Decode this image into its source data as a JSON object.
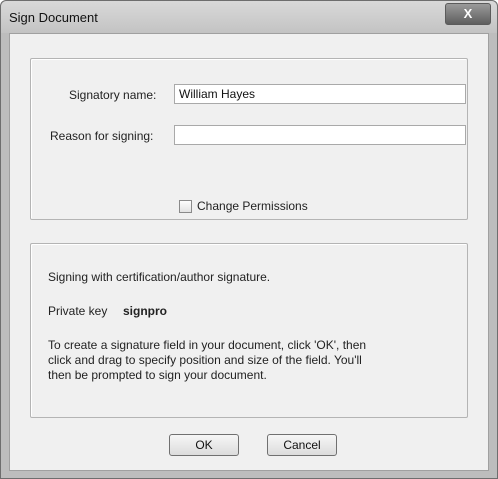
{
  "window": {
    "title": "Sign Document",
    "close_glyph": "X"
  },
  "signatory": {
    "name_label": "Signatory name:",
    "name_value": "William Hayes",
    "reason_label": "Reason for signing:",
    "reason_value": "",
    "permissions_label": "Change Permissions",
    "permissions_checked": false
  },
  "info": {
    "signing_text": "Signing with certification/author signature.",
    "private_key_label": "Private key",
    "private_key_value": "signpro",
    "instructions_line1": "To create a signature field in your document, click 'OK', then",
    "instructions_line2": "click and drag to specify position and size of the field. You'll",
    "instructions_line3": "then be prompted to sign your document."
  },
  "buttons": {
    "ok_label": "OK",
    "cancel_label": "Cancel"
  }
}
